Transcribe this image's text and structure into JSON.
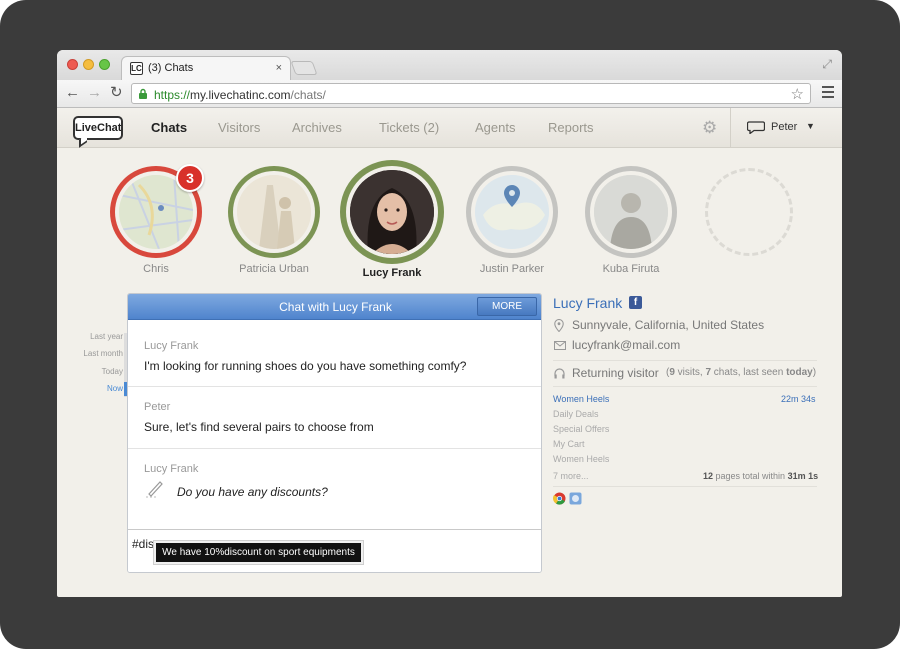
{
  "browser": {
    "tab_title": "(3) Chats",
    "tab_favicon": "LC",
    "tab_close": "×",
    "url_https": "https://",
    "url_host": "my.livechatinc.com",
    "url_path": "/chats/"
  },
  "app": {
    "logo": "LiveChat",
    "nav": [
      {
        "label": "Chats"
      },
      {
        "label": "Visitors"
      },
      {
        "label": "Archives"
      },
      {
        "label": "Tickets (2)"
      },
      {
        "label": "Agents"
      },
      {
        "label": "Reports"
      }
    ],
    "user": "Peter",
    "user_caret": "▼"
  },
  "visitors": [
    {
      "name": "Chris",
      "badge": "3"
    },
    {
      "name": "Patricia Urban"
    },
    {
      "name": "Lucy Frank"
    },
    {
      "name": "Justin Parker"
    },
    {
      "name": "Kuba Firuta"
    }
  ],
  "timeline": [
    "Last year",
    "Last month",
    "Today",
    "Now"
  ],
  "chat": {
    "title": "Chat with Lucy Frank",
    "more": "MORE",
    "messages": [
      {
        "author": "Lucy Frank",
        "text": "I'm looking for running shoes do you have something comfy?"
      },
      {
        "author": "Peter",
        "text": "Sure, let's find several pairs to choose from"
      },
      {
        "author": "Lucy Frank",
        "text": "Do you have any discounts?"
      }
    ],
    "input_value": "#dis",
    "suggestion": "We have 10%discount on sport equipments"
  },
  "visitor_info": {
    "name": "Lucy Frank",
    "fb": "f",
    "location": "Sunnyvale, California, United States",
    "email": "lucyfrank@mail.com",
    "returning_label": "Returning visitor",
    "returning_open": "(",
    "visits_count": "9",
    "visits_word": " visits, ",
    "chats_count": "7",
    "chats_rest": " chats, last seen ",
    "last_seen": "today",
    "returning_close": ")",
    "pages": [
      "Women Heels",
      "Daily Deals",
      "Special Offers",
      "My Cart",
      "Women Heels",
      "7 more..."
    ],
    "time_on_page": "22m 34s",
    "pages_total_count": "12",
    "pages_total_mid": " pages total within ",
    "pages_total_time": "31m 1s"
  }
}
